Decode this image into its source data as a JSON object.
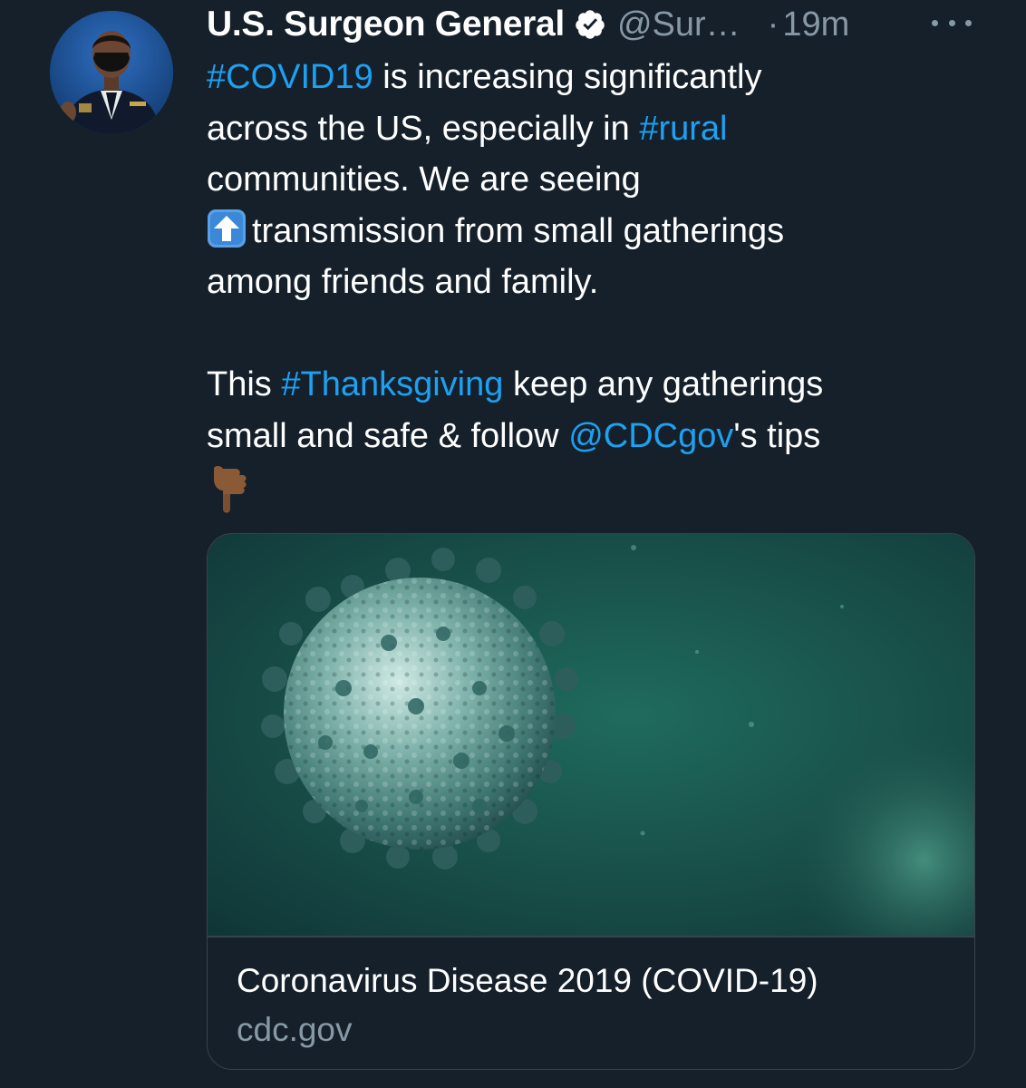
{
  "tweet": {
    "author": {
      "display_name": "U.S. Surgeon General",
      "handle": "@Sur…",
      "verified_icon": "verified-badge-icon"
    },
    "separator": "·",
    "timestamp": "19m",
    "more_icon": "more-options-icon",
    "text": {
      "l1_hashtag": "#COVID19",
      "l1_rest": " is increasing significantly",
      "l2_start": "across the US, especially in ",
      "l2_hashtag": "#rural",
      "l3": "communities. We are seeing",
      "l4_emoji": "up-arrow-emoji",
      "l4_rest": "transmission from small gatherings",
      "l5": "among friends and family.",
      "l6_start": "This ",
      "l6_hashtag": "#Thanksgiving",
      "l6_rest": " keep any gatherings",
      "l7_start": "small and safe & follow ",
      "l7_mention": "@CDCgov",
      "l7_rest": "'s tips",
      "l8_emoji": "pointing-down-emoji"
    },
    "colors": {
      "background": "#15202b",
      "link": "#1da1f2",
      "secondary_text": "#8899a6",
      "border": "#38444d"
    }
  },
  "link_card": {
    "image_icon": "coronavirus-image",
    "title": "Coronavirus Disease 2019 (COVID-19)",
    "domain": "cdc.gov"
  }
}
